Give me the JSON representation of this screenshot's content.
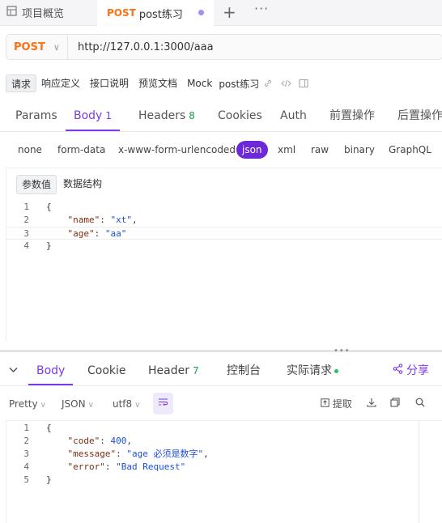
{
  "tabs": {
    "overview": "项目概览",
    "active_method": "POST",
    "active_title": "post练习",
    "plus": "+",
    "more": "···"
  },
  "request": {
    "method": "POST",
    "url": "http://127.0.0.1:3000/aaa"
  },
  "subtabs": {
    "items": [
      "请求",
      "响应定义",
      "接口说明",
      "预览文档",
      "Mock"
    ],
    "name": "post练习"
  },
  "param_tabs": [
    {
      "label": "Params",
      "count": ""
    },
    {
      "label": "Body",
      "count": "1"
    },
    {
      "label": "Headers",
      "count": "8"
    },
    {
      "label": "Cookies",
      "count": ""
    },
    {
      "label": "Auth",
      "count": ""
    },
    {
      "label": "前置操作",
      "count": ""
    },
    {
      "label": "后置操作",
      "count": ""
    }
  ],
  "body_types": [
    "none",
    "form-data",
    "x-www-form-urlencoded",
    "json",
    "xml",
    "raw",
    "binary",
    "GraphQL"
  ],
  "editor": {
    "seg_active": "参数值",
    "seg_other": "数据结构",
    "lines": [
      {
        "n": "1",
        "text": "{"
      },
      {
        "n": "2",
        "key": "\"name\"",
        "val": "\"xt\"",
        "tail": ","
      },
      {
        "n": "3",
        "key": "\"age\"",
        "val": "\"aa\"",
        "tail": ""
      },
      {
        "n": "4",
        "text": "}"
      }
    ]
  },
  "response_tabs": [
    {
      "label": "Body",
      "count": ""
    },
    {
      "label": "Cookie",
      "count": ""
    },
    {
      "label": "Header",
      "count": "7"
    },
    {
      "label": "控制台",
      "count": ""
    },
    {
      "label": "实际请求",
      "count": ""
    }
  ],
  "share_label": "分享",
  "response_toolbar": {
    "format": "Pretty",
    "lang": "JSON",
    "encoding": "utf8",
    "extract": "提取"
  },
  "response_body": {
    "lines": [
      {
        "n": "1",
        "text": "{"
      },
      {
        "n": "2",
        "key": "\"code\"",
        "val": "400",
        "tail": ","
      },
      {
        "n": "3",
        "key": "\"message\"",
        "val": "\"age 必须是数字\"",
        "tail": ","
      },
      {
        "n": "4",
        "key": "\"error\"",
        "val": "\"Bad Request\"",
        "tail": ""
      },
      {
        "n": "5",
        "text": "}"
      }
    ]
  },
  "colors": {
    "accent": "#7c3aed",
    "method": "#f97316",
    "count_green": "#16a34a"
  }
}
